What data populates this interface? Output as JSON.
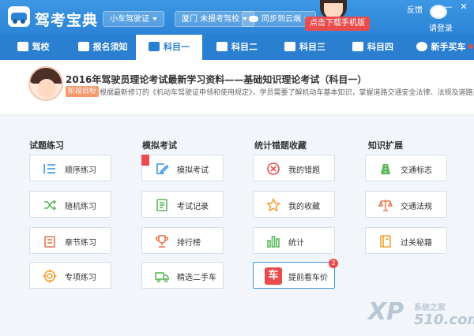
{
  "header": {
    "app_title": "驾考宝典",
    "license_type": "小车驾驶证",
    "region_school": "厦门 未报考驾校",
    "sync_label": "同步到云端",
    "download_button": "点击下载手机版",
    "feedback": "反馈",
    "window_controls": {
      "minimize": "—",
      "close": "✕"
    },
    "login": "请登录"
  },
  "nav": {
    "items": [
      {
        "label": "驾校",
        "icon": "home-icon"
      },
      {
        "label": "报名须知",
        "icon": "document-icon"
      },
      {
        "label": "科目一",
        "icon": "edit-icon",
        "active": true
      },
      {
        "label": "科目二",
        "icon": "road-cone-icon"
      },
      {
        "label": "科目三",
        "icon": "car-icon"
      },
      {
        "label": "科目四",
        "icon": "book-icon"
      },
      {
        "label": "新手买车",
        "icon": "steering-wheel-icon"
      }
    ]
  },
  "banner": {
    "title": "2016年驾驶员理论考试最新学习资料——基础知识理论考试（科目一）",
    "stage_tag": "阶段目标",
    "description": "根据最新修订的《机动车驾驶证申领和使用规定》，学员需要了解机动车基本知识，掌握道路交通安全法律、法规及道路交通..."
  },
  "sections": {
    "practice": {
      "title": "试题练习",
      "items": [
        "顺序练习",
        "随机练习",
        "章节练习",
        "专项练习"
      ]
    },
    "mock": {
      "title": "模拟考试",
      "items": [
        "模拟考试",
        "考试记录",
        "排行榜",
        "精选二手车"
      ]
    },
    "stats": {
      "title": "统计错题收藏",
      "items": [
        "我的错题",
        "我的收藏",
        "统计",
        "提前看车价"
      ],
      "badge": "2"
    },
    "knowledge": {
      "title": "知识扩展",
      "items": [
        "交通标志",
        "交通法规",
        "过关秘籍"
      ]
    }
  },
  "watermark": {
    "logo": "XP",
    "text": "系统之家",
    "number": "510.com"
  },
  "colors": {
    "primary": "#2a7fd0",
    "accent_red": "#e94c4c",
    "green": "#5cb85c",
    "orange": "#f49a6c"
  }
}
